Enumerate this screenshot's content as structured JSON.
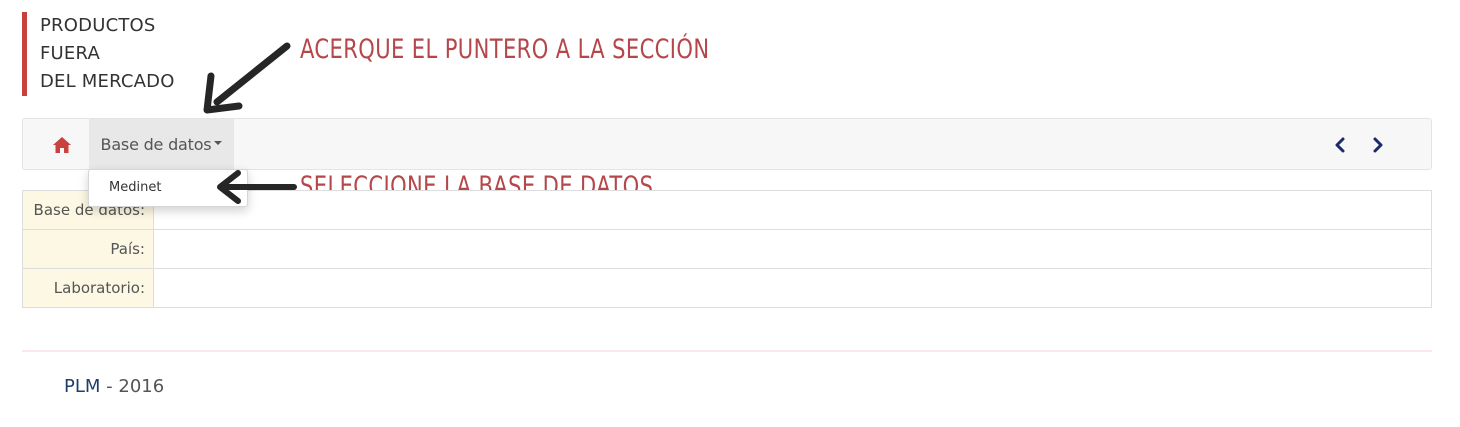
{
  "header": {
    "title_lines": [
      "PRODUCTOS",
      "FUERA",
      "DEL MERCADO"
    ],
    "accent_color": "#c9413f"
  },
  "navbar": {
    "home_icon": "home-icon",
    "menu_label": "Base de datos",
    "prev_icon": "chevron-left-icon",
    "next_icon": "chevron-right-icon"
  },
  "dropdown": {
    "items": [
      "Medinet"
    ]
  },
  "table": {
    "rows": [
      {
        "label": "Base de datos:",
        "value": ""
      },
      {
        "label": "País:",
        "value": ""
      },
      {
        "label": "Laboratorio:",
        "value": ""
      }
    ]
  },
  "footer": {
    "brand": "PLM",
    "rest": " - 2016"
  },
  "annotations": {
    "step1": "ACERQUE EL PUNTERO A LA SECCIÓN",
    "step2": "SELECCIONE LA BASE DE DATOS"
  }
}
